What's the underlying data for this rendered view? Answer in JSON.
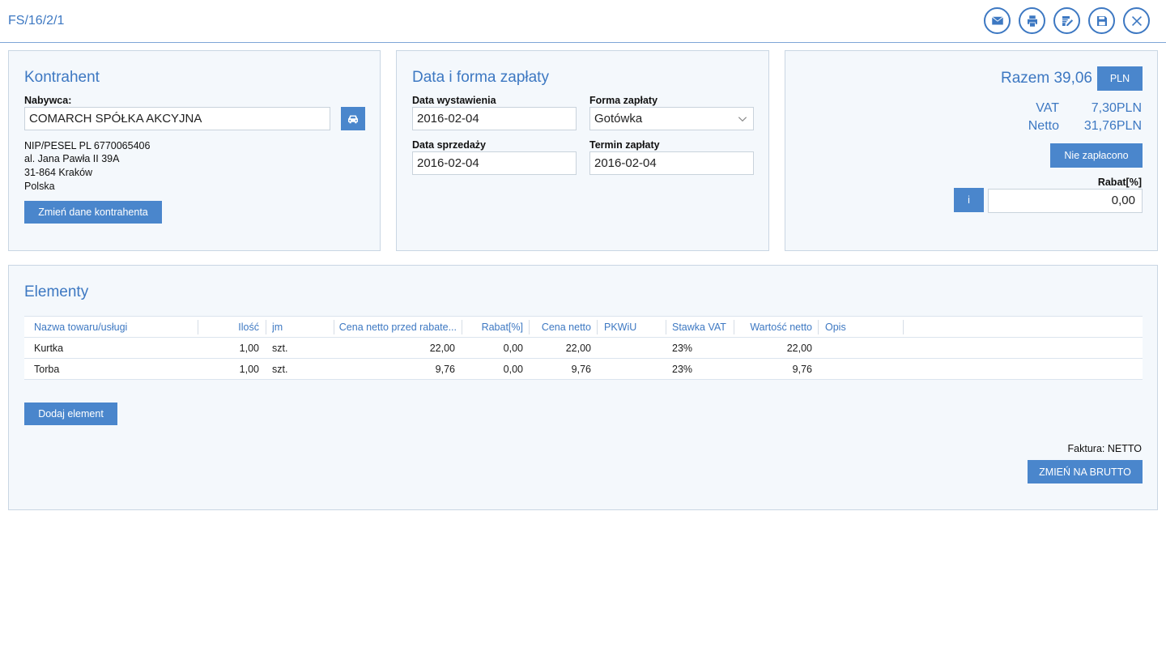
{
  "header": {
    "doc_number": "FS/16/2/1",
    "tools": [
      {
        "name": "mail-icon"
      },
      {
        "name": "print-icon"
      },
      {
        "name": "edit-document-icon"
      },
      {
        "name": "save-icon"
      },
      {
        "name": "close-icon"
      }
    ]
  },
  "contractor": {
    "title": "Kontrahent",
    "buyer_label": "Nabywca:",
    "buyer_value": "COMARCH SPÓŁKA AKCYJNA",
    "nip": "NIP/PESEL PL 6770065406",
    "street": "al. Jana Pawła II 39A",
    "city": "31-864 Kraków",
    "country": "Polska",
    "change_button": "Zmień dane kontrahenta"
  },
  "payment": {
    "title": "Data i forma zapłaty",
    "issue_date_label": "Data wystawienia",
    "issue_date": "2016-02-04",
    "payment_form_label": "Forma zapłaty",
    "payment_form": "Gotówka",
    "sale_date_label": "Data sprzedaży",
    "sale_date": "2016-02-04",
    "due_date_label": "Termin zapłaty",
    "due_date": "2016-02-04"
  },
  "summary": {
    "total_label": "Razem 39,06",
    "currency": "PLN",
    "vat_label": "VAT",
    "vat_value": "7,30PLN",
    "net_label": "Netto",
    "net_value": "31,76PLN",
    "status_button": "Nie zapłacono",
    "discount_label": "Rabat[%]",
    "info_button": "i",
    "discount_value": "0,00"
  },
  "elements": {
    "title": "Elementy",
    "columns": [
      "Nazwa towaru/usługi",
      "Ilość",
      "jm",
      "Cena netto przed rabate...",
      "Rabat[%]",
      "Cena netto",
      "PKWiU",
      "Stawka VAT",
      "Wartość netto",
      "Opis"
    ],
    "rows": [
      {
        "name": "Kurtka",
        "qty": "1,00",
        "unit": "szt.",
        "price_before": "22,00",
        "discount": "0,00",
        "net_price": "22,00",
        "pkwiu": "",
        "vat_rate": "23%",
        "net_value": "22,00",
        "desc": ""
      },
      {
        "name": "Torba",
        "qty": "1,00",
        "unit": "szt.",
        "price_before": "9,76",
        "discount": "0,00",
        "net_price": "9,76",
        "pkwiu": "",
        "vat_rate": "23%",
        "net_value": "9,76",
        "desc": ""
      }
    ],
    "add_button": "Dodaj element",
    "invoice_type": "Faktura: NETTO",
    "switch_button": "ZMIEŃ NA BRUTTO"
  }
}
